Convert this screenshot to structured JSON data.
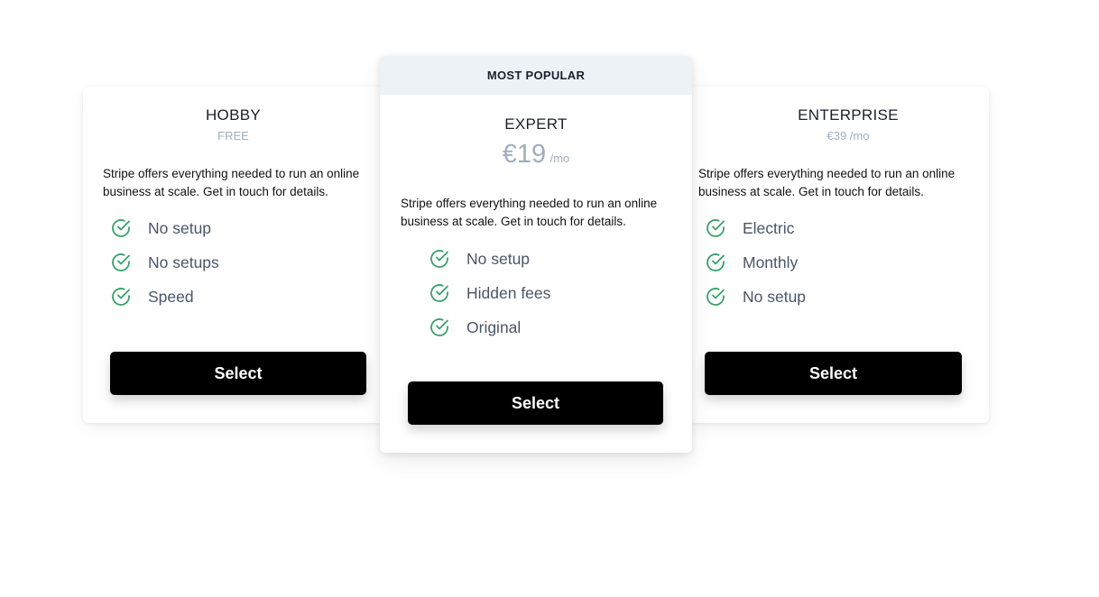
{
  "plans": [
    {
      "name": "HOBBY",
      "price": "FREE",
      "description": "Stripe offers everything needed to run an online business at scale. Get in touch for details.",
      "features": [
        "No setup",
        "No setups",
        "Speed"
      ],
      "cta": "Select"
    },
    {
      "badge": "MOST POPULAR",
      "name": "EXPERT",
      "price_amount": "€19",
      "price_period": "/mo",
      "description": "Stripe offers everything needed to run an online business at scale. Get in touch for details.",
      "features": [
        "No setup",
        "Hidden fees",
        "Original"
      ],
      "cta": "Select"
    },
    {
      "name": "ENTERPRISE",
      "price": "€39 /mo",
      "description": "Stripe offers everything needed to run an online business at scale. Get in touch for details.",
      "features": [
        "Electric",
        "Monthly",
        "No setup"
      ],
      "cta": "Select"
    }
  ],
  "icons": {
    "feature_check": "check-circle-icon"
  },
  "colors": {
    "check_green": "#38a169",
    "button_bg": "#000000",
    "badge_bg": "#edf2f7",
    "price_muted": "#a0aec0",
    "feature_text": "#4a5568"
  }
}
